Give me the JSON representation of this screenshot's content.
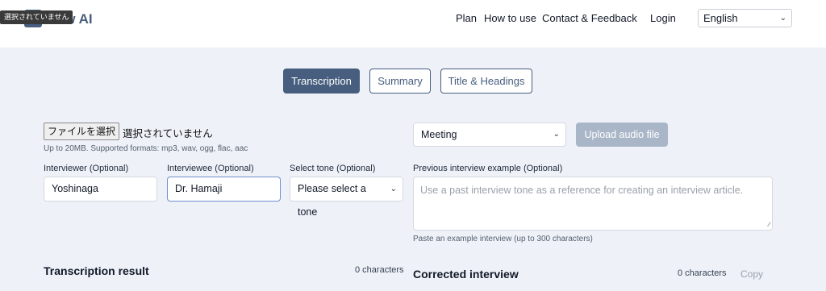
{
  "header": {
    "brand": "rview AI",
    "tooltip": "選択されていません",
    "nav": [
      "Plan",
      "How to use",
      "Contact & Feedback",
      "Login"
    ],
    "language": "English"
  },
  "tabs": [
    "Transcription",
    "Summary",
    "Title & Headings"
  ],
  "active_tab": "Transcription",
  "upload": {
    "file_button": "ファイルを選択",
    "file_status": "選択されていません",
    "hint": "Up to 20MB. Supported formats: mp3, wav, ogg, flac, aac",
    "type_select": "Meeting",
    "upload_button": "Upload audio file"
  },
  "form": {
    "interviewer_label": "Interviewer (Optional)",
    "interviewer_value": "Yoshinaga",
    "interviewee_label": "Interviewee (Optional)",
    "interviewee_value": "Dr. Hamaji",
    "tone_label": "Select tone (Optional)",
    "tone_value": "Please select a tone",
    "example_label": "Previous interview example (Optional)",
    "example_placeholder": "Use a past interview tone as a reference for creating an interview article.",
    "example_hint": "Paste an example interview (up to 300 characters)"
  },
  "results": {
    "transcription_title": "Transcription result",
    "transcription_count": "0 characters",
    "corrected_title": "Corrected interview",
    "corrected_count": "0 characters",
    "copy_label": "Copy"
  },
  "colors": {
    "accent": "#475e7e",
    "background": "#eef2f8",
    "upload_disabled": "#a9b6c8"
  }
}
